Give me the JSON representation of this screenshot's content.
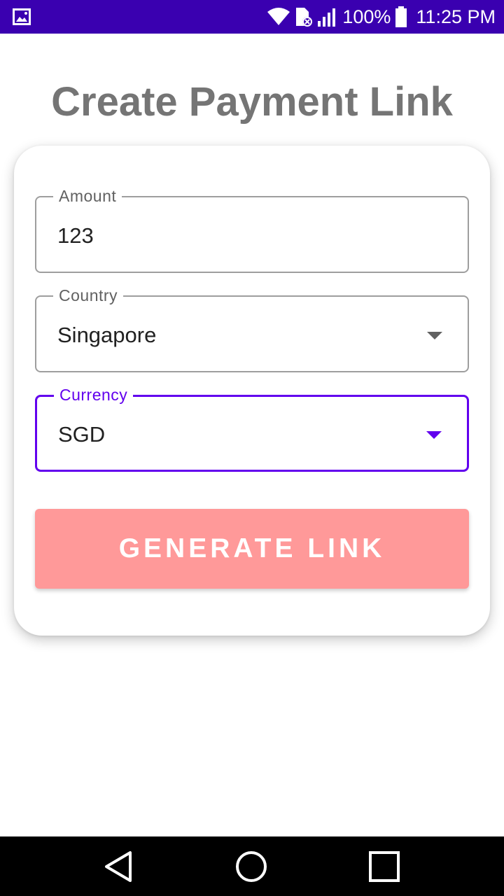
{
  "status_bar": {
    "battery_text": "100%",
    "time": "11:25 PM",
    "icons": [
      "gallery-icon",
      "wifi-icon",
      "sim-error-icon",
      "signal-icon",
      "battery-icon"
    ],
    "color": "#3a00b0"
  },
  "page": {
    "title": "Create Payment Link"
  },
  "form": {
    "amount": {
      "label": "Amount",
      "value": "123"
    },
    "country": {
      "label": "Country",
      "value": "Singapore"
    },
    "currency": {
      "label": "Currency",
      "value": "SGD"
    },
    "generate_button_label": "GENERATE LINK"
  },
  "nav_bar": {
    "icons": [
      "back-icon",
      "home-icon",
      "recents-icon"
    ]
  },
  "colors": {
    "accent": "#6200ee",
    "button_bg": "#ff9999",
    "title": "#757575"
  }
}
